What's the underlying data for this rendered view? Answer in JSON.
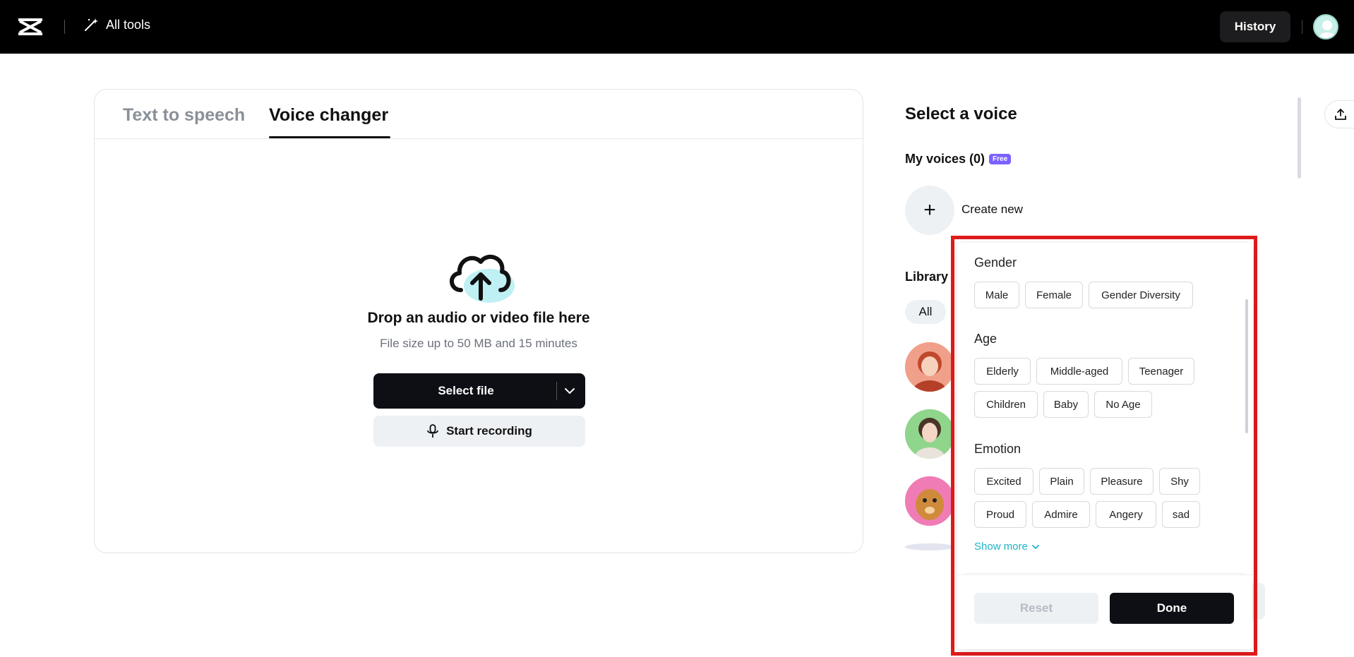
{
  "topbar": {
    "all_tools_label": "All tools",
    "history_label": "History"
  },
  "tabs": [
    {
      "label": "Text to speech",
      "active": false
    },
    {
      "label": "Voice changer",
      "active": true
    }
  ],
  "upload": {
    "title": "Drop an audio or video file here",
    "subtitle": "File size up to 50 MB and 15 minutes",
    "select_file_label": "Select file",
    "start_recording_label": "Start recording"
  },
  "voice_panel": {
    "title": "Select a voice",
    "my_voices_label": "My voices (0)",
    "free_badge": "Free",
    "create_new_label": "Create new",
    "library_label": "Library",
    "all_filter_label": "All"
  },
  "filter": {
    "gender": {
      "title": "Gender",
      "options": [
        "Male",
        "Female",
        "Gender Diversity"
      ]
    },
    "age": {
      "title": "Age",
      "options": [
        "Elderly",
        "Middle-aged",
        "Teenager",
        "Children",
        "Baby",
        "No Age"
      ]
    },
    "emotion": {
      "title": "Emotion",
      "options": [
        "Excited",
        "Plain",
        "Pleasure",
        "Shy",
        "Proud",
        "Admire",
        "Angery",
        "sad"
      ]
    },
    "show_more_label": "Show more",
    "reset_label": "Reset",
    "done_label": "Done"
  },
  "colors": {
    "highlight": "#e01b1b",
    "accent_link": "#1fb3c9",
    "badge": "#7b61ff",
    "primary_button": "#0d0f14"
  }
}
